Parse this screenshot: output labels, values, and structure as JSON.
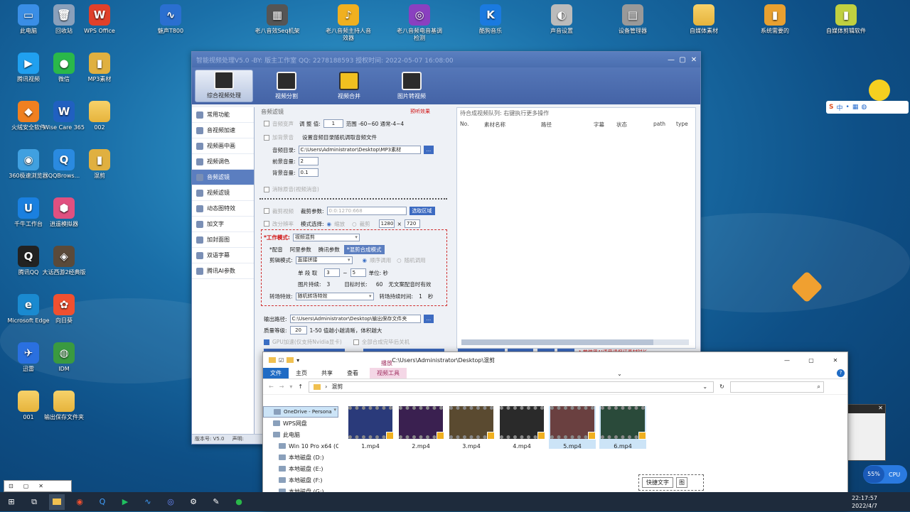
{
  "desktop": {
    "icons": [
      {
        "label": "此电脑",
        "glyph": "▭",
        "color": "#3a8ee6"
      },
      {
        "label": "回收站",
        "glyph": "🗑",
        "color": "#8aa0bb"
      },
      {
        "label": "WPS Office",
        "glyph": "W",
        "color": "#e0402a"
      },
      {
        "label": "魅声T800",
        "glyph": "∿",
        "color": "#2a6fd0"
      },
      {
        "label": "老八音效Seq机架",
        "glyph": "▦",
        "color": "#555"
      },
      {
        "label": "老八音频主持人音效器",
        "glyph": "♪",
        "color": "#f0b020"
      },
      {
        "label": "老八音频电音基调检测",
        "glyph": "◎",
        "color": "#8a40c0"
      },
      {
        "label": "酷狗音乐",
        "glyph": "K",
        "color": "#1a7ae0"
      },
      {
        "label": "声音设置",
        "glyph": "◐",
        "color": "#bbb"
      },
      {
        "label": "设备管理器",
        "glyph": "▤",
        "color": "#999"
      },
      {
        "label": "自媒体素材",
        "glyph": "",
        "color": "#f0c050"
      },
      {
        "label": "系统需要的",
        "glyph": "▮",
        "color": "#e8a030"
      },
      {
        "label": "自媒体剪辑软件",
        "glyph": "▮",
        "color": "#c0d040"
      },
      {
        "label": "腾讯视频",
        "glyph": "▶",
        "color": "#20a0f0"
      },
      {
        "label": "微信",
        "glyph": "●",
        "color": "#2ab84a"
      },
      {
        "label": "MP3素材",
        "glyph": "▮",
        "color": "#e0b040"
      },
      {
        "label": "火绒安全软件",
        "glyph": "◆",
        "color": "#f08020"
      },
      {
        "label": "Wise Care 365",
        "glyph": "W",
        "color": "#2060c0"
      },
      {
        "label": "002",
        "glyph": "",
        "color": "#f0c050"
      },
      {
        "label": "360极速浏览器",
        "glyph": "◉",
        "color": "#40a0e0"
      },
      {
        "label": "QQBrows...",
        "glyph": "Q",
        "color": "#2a8ae0"
      },
      {
        "label": "混剪",
        "glyph": "▮",
        "color": "#e0b040"
      },
      {
        "label": "千牛工作台",
        "glyph": "U",
        "color": "#1a80e0"
      },
      {
        "label": "逍遥模拟器",
        "glyph": "⬢",
        "color": "#e05080"
      },
      {
        "label": "腾讯QQ",
        "glyph": "Q",
        "color": "#222"
      },
      {
        "label": "大话西游2经典版",
        "glyph": "◈",
        "color": "#5a4a3a"
      },
      {
        "label": "Microsoft Edge",
        "glyph": "e",
        "color": "#1a8ad0"
      },
      {
        "label": "向日葵",
        "glyph": "✿",
        "color": "#f05030"
      },
      {
        "label": "迅雷",
        "glyph": "✈",
        "color": "#2a70e0"
      },
      {
        "label": "IDM",
        "glyph": "◍",
        "color": "#3a9a40"
      },
      {
        "label": "001",
        "glyph": "",
        "color": "#f0c050"
      },
      {
        "label": "输出保存文件夹",
        "glyph": "",
        "color": "#f0c050"
      }
    ]
  },
  "app": {
    "title": "智能视频处理V5.0 -BY: 版主工作室 QQ: 2278188593 授权时间: 2022-05-07 16:08:00",
    "toolbar": [
      "综合视频处理",
      "视频分割",
      "视频合并",
      "图片转视频"
    ],
    "sidebar": [
      "常用功能",
      "音视频加速",
      "视频画中画",
      "视频调色",
      "音频滤镜",
      "视频滤镜",
      "动态图特效",
      "加文字",
      "加封面图",
      "双语字幕",
      "腾讯AI参数"
    ],
    "version": "版本号: V5.0",
    "version_extra": "声明:",
    "audio": {
      "title": "音频滤镜",
      "preview": "预听效果",
      "pitch_label": "音频变声",
      "pitch_adjust": "调 整 值:",
      "pitch_value": "1",
      "pitch_range": "范围 -60~60 通常-4~4",
      "bgm_label": "加背景音",
      "bgm_desc": "设置音频目录随机调取音频文件",
      "dir_label": "音频目录:",
      "dir_value": "C:\\Users\\Administrator\\Desktop\\MP3素材",
      "fg_label": "前景音量:",
      "fg_value": "2",
      "bg_label": "背景音量:",
      "bg_value": "0.1",
      "mute_label": "消除原音(视频消音)"
    },
    "crop": {
      "label": "裁剪视频",
      "params_label": "裁剪参数:",
      "params_value": "0:0:1270:668",
      "select_btn": "选取区域",
      "res_label": "改分辨率",
      "mode_label": "模式选择:",
      "opt_scale": "缩放",
      "opt_crop": "裁剪",
      "w": "1280",
      "x": "×",
      "h": "720"
    },
    "work": {
      "label": "*工作模式:",
      "value": "视频混剪",
      "tabs": [
        "*配音",
        "阿里参数",
        "腾讯参数",
        "*混剪合成模式"
      ],
      "cut_label": "剪辑模式:",
      "cut_value": "直接拼接",
      "opt_seq": "顺序调用",
      "opt_rand": "随机调用",
      "seg_label": "单 段 取",
      "seg_a": "3",
      "seg_b": "5",
      "seg_unit": "单位: 秒",
      "img_label": "图片持续:",
      "img_value": "3",
      "target_label": "目标时长:",
      "target_value": "60",
      "target_note": "无文案配音时有效",
      "trans_label": "转场特效:",
      "trans_value": "随机转场特效",
      "trans_time_label": "转场持续时间:",
      "trans_time_value": "1",
      "trans_time_unit": "秒"
    },
    "output": {
      "path_label": "输出路径:",
      "path_value": "C:\\Users\\Administrator\\Desktop\\输出保存文件夹",
      "quality_label": "质量等级:",
      "quality_value": "20",
      "quality_note": "1-50 值越小越清晰，体积越大",
      "gpu_label": "GPU加速(仅支持Nvidia显卡)",
      "shutdown_label": "全部合成完毕后关机"
    },
    "queue": {
      "title": "待合成视频队列: 右键执行更多操作",
      "cols": [
        "No.",
        "素材名称",
        "路径",
        "字幕",
        "状态",
        "path",
        "type"
      ],
      "hint": "* 若使用AI语音请保证素材时长"
    }
  },
  "explorer": {
    "path": "C:\\Users\\Administrator\\Desktop\\混剪",
    "ribbon_tabs": [
      "文件",
      "主页",
      "共享",
      "查看"
    ],
    "play_tab": "播放",
    "video_tools": "视频工具",
    "breadcrumb": "混剪",
    "nav": [
      "OneDrive - Persona",
      "WPS网盘",
      "此电脑",
      "Win 10 Pro x64 (C",
      "本地磁盘 (D:)",
      "本地磁盘 (E:)",
      "本地磁盘 (F:)",
      "本地磁盘 (G:)"
    ],
    "files": [
      {
        "name": "1.mp4",
        "color": "#2a3a7a"
      },
      {
        "name": "2.mp4",
        "color": "#3a2050"
      },
      {
        "name": "3.mp4",
        "color": "#5a4a30"
      },
      {
        "name": "4.mp4",
        "color": "#2a2a2a"
      },
      {
        "name": "5.mp4",
        "color": "#6a4040"
      },
      {
        "name": "6.mp4",
        "color": "#2a4a3a"
      }
    ],
    "quick_text": "快捷文字",
    "quick_icon": "图"
  },
  "taskbar": {
    "time": "22:17:57",
    "date": "2022/4/7",
    "cpu": "55%",
    "cpu_label": "CPU"
  },
  "mini": {
    "label": "⊡"
  }
}
